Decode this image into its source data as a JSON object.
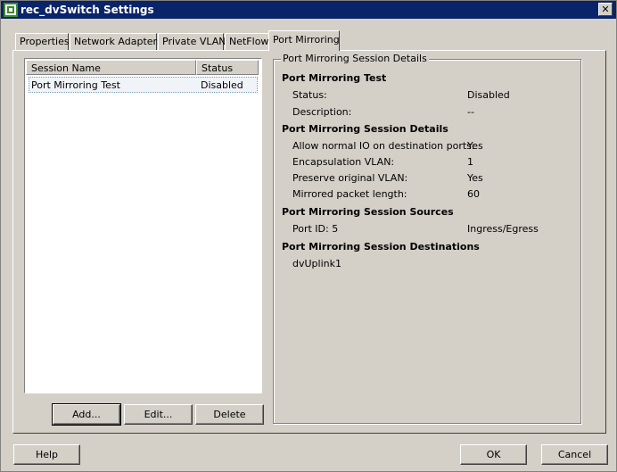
{
  "window": {
    "title": "rec_dvSwitch Settings",
    "close_label": "✕"
  },
  "tabs": [
    {
      "label": "Properties"
    },
    {
      "label": "Network Adapters"
    },
    {
      "label": "Private VLAN"
    },
    {
      "label": "NetFlow"
    },
    {
      "label": "Port Mirroring",
      "active": true
    }
  ],
  "sessions": {
    "columns": [
      "Session Name",
      "Status"
    ],
    "rows": [
      {
        "name": "Port Mirroring Test",
        "status": "Disabled"
      }
    ],
    "buttons": {
      "add": "Add...",
      "edit": "Edit...",
      "delete": "Delete"
    }
  },
  "details": {
    "group_title": "Port Mirroring Session Details",
    "session_title": "Port Mirroring Test",
    "status_label": "Status:",
    "status_value": "Disabled",
    "description_label": "Description:",
    "description_value": "--",
    "section_details": "Port Mirroring Session Details",
    "allow_io_label": "Allow normal IO on destination ports:",
    "allow_io_value": "Yes",
    "encap_vlan_label": "Encapsulation VLAN:",
    "encap_vlan_value": "1",
    "preserve_vlan_label": "Preserve original VLAN:",
    "preserve_vlan_value": "Yes",
    "packet_length_label": "Mirrored packet length:",
    "packet_length_value": "60",
    "section_sources": "Port Mirroring Session Sources",
    "port_id_label": "Port ID: 5",
    "port_id_value": "Ingress/Egress",
    "section_destinations": "Port Mirroring Session Destinations",
    "destination_value": "dvUplink1"
  },
  "footer": {
    "help": "Help",
    "ok": "OK",
    "cancel": "Cancel"
  },
  "colors": {
    "titlebar": "#0a246a",
    "face": "#d4d0c8"
  }
}
